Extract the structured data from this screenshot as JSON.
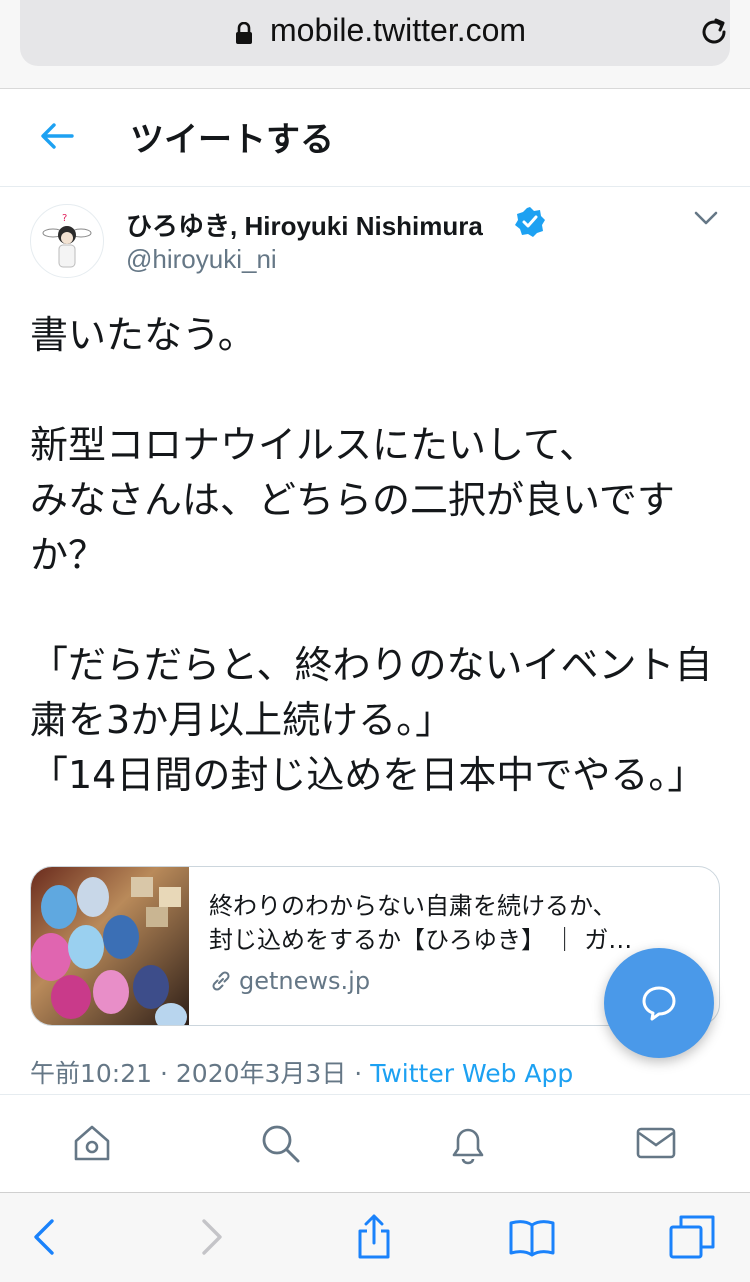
{
  "browser": {
    "url": "mobile.twitter.com",
    "icons": [
      "lock-icon",
      "reload-icon"
    ]
  },
  "header": {
    "title": "ツイートする",
    "back_icon": "back-arrow-icon"
  },
  "tweet": {
    "author": {
      "display_name": "ひろゆき, Hiroyuki Nishimura",
      "handle": "@hiroyuki_ni",
      "verified": true
    },
    "text": "書いたなう。\n\n新型コロナウイルスにたいして、\nみなさんは、どちらの二択が良いですか？\n\n「だらだらと、終わりのないイベント自粛を3か月以上続ける。」\n「14日間の封じ込めを日本中でやる。」",
    "card": {
      "title_line1": "終わりのわからない自粛を続けるか、",
      "title_line2": "封じ込めをするか【ひろゆき】 ｜ ガ…",
      "domain": "getnews.jp"
    },
    "time": "午前10:21",
    "date": "2020年3月3日",
    "source": "Twitter Web App",
    "separator": "·"
  },
  "colors": {
    "accent": "#1da1f2",
    "fab": "#4a99e9",
    "text": "#14171a",
    "secondary": "#657786"
  },
  "twitter_nav": [
    "home-icon",
    "search-icon",
    "notifications-icon",
    "messages-icon"
  ],
  "safari_toolbar": [
    "back-icon",
    "forward-icon",
    "share-icon",
    "bookmarks-icon",
    "tabs-icon"
  ]
}
